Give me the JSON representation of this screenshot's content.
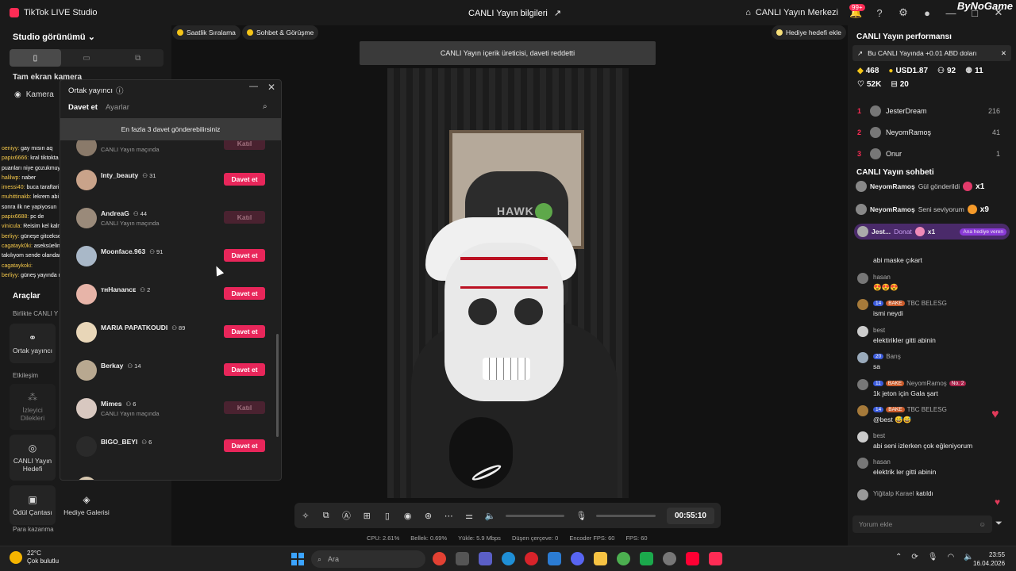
{
  "titlebar": {
    "app_name": "TikTok LIVE Studio",
    "live_info": "CANLI Yayın bilgileri",
    "live_center": "CANLI Yayın Merkezi",
    "notif_badge": "99+",
    "brand": "ByNoGame"
  },
  "left": {
    "studio_view": "Studio görünümü",
    "fullscreen_camera": "Tam ekran kamera",
    "camera": "Kamera",
    "tools_title": "Araçlar",
    "together_label": "Birlikte CANLI Y",
    "cohost": "Ortak yayıncı",
    "interaction_label": "Etkileşim",
    "viewer_requests": "İzleyici Dilekleri",
    "live_goal": "CANLI Yayın Hedefi",
    "reward_bag": "Ödül Çantası",
    "gift_gallery": "Hediye Galerisi",
    "earn_label": "Para kazanma",
    "overlay_chat": [
      {
        "user": "oeniyy:",
        "text": "gay mısın aq"
      },
      {
        "user": "papix6666:",
        "text": "kral tiktokta savas puanları niye gozukmuyor"
      },
      {
        "user": "halilwp:",
        "text": "naber"
      },
      {
        "user": "imessi40:",
        "text": "buca taraftari"
      },
      {
        "user": "muhittinakb:",
        "text": "lekrem abi uyandıktan sonra ilk ne yapiyosun"
      },
      {
        "user": "papix6688:",
        "text": "pc de"
      },
      {
        "user": "vinicula:",
        "text": "Reisim kel kalmışsın"
      },
      {
        "user": "berliyy:",
        "text": "güneşe gitcekse durcan"
      },
      {
        "user": "cagatayk0ki:",
        "text": "aseksüelim dalgasına takılıyom sende olandan"
      },
      {
        "user": "cagataykoki:",
        "text": ""
      },
      {
        "user": "berliyy:",
        "text": "güneş yayında mı"
      }
    ]
  },
  "top_pills": {
    "ranking": "Saatlik Sıralama",
    "chat_meet": "Sohbet & Görüşme",
    "gift_goal": "Hediye hedefi ekle"
  },
  "notification": "CANLI Yayın içerik üreticisi, daveti reddetti",
  "video": {
    "chair_text": "HAWK"
  },
  "dialog": {
    "title": "Ortak yayıncı",
    "tab_invite": "Davet et",
    "tab_settings": "Ayarlar",
    "limit_notice": "En fazla 3 davet gönderebilirsiniz",
    "items": [
      {
        "name": "Inty_beauty",
        "followers": "31",
        "sub": "",
        "action": "Davet et"
      },
      {
        "name": "AndreaG",
        "followers": "44",
        "sub": "CANLI Yayın maçında",
        "action": "Katıl"
      },
      {
        "name": "Moonface.963",
        "followers": "91",
        "sub": "",
        "action": "Davet et"
      },
      {
        "name": "тнHananᴄᴇ",
        "followers": "2",
        "sub": "",
        "action": "Davet et"
      },
      {
        "name": "MARIA PAPATKOUDI",
        "followers": "89",
        "sub": "",
        "action": "Davet et"
      },
      {
        "name": "Berkay",
        "followers": "14",
        "sub": "",
        "action": "Davet et"
      },
      {
        "name": "Mimes",
        "followers": "6",
        "sub": "CANLI Yayın maçında",
        "action": "Katıl"
      },
      {
        "name": "BIGO_BEYI",
        "followers": "6",
        "sub": "",
        "action": "Davet et"
      }
    ],
    "partial_top_sub": "CANLI Yayın maçında",
    "partial_top_action": "Katıl"
  },
  "toolbar": {
    "timer": "00:55:10"
  },
  "stats": {
    "cpu": "CPU: 2.61%",
    "memory": "Bellek: 0.69%",
    "upload": "Yükle: 5.9 Mbps",
    "dropped": "Düşen çerçeve: 0",
    "encoder_fps": "Encoder FPS: 60",
    "fps": "FPS: 60"
  },
  "right": {
    "perf_title": "CANLI Yayın performansı",
    "earn_notice": "Bu CANLI Yayında +0.01 ABD doları",
    "diamonds": "468",
    "usd": "USD1.87",
    "viewers": "92",
    "new_followers": "11",
    "likes": "52K",
    "gifters": "20",
    "ranking": [
      {
        "rank": "1",
        "name": "JesterDream",
        "score": "216"
      },
      {
        "rank": "2",
        "name": "NeyomRamoş",
        "score": "41"
      },
      {
        "rank": "3",
        "name": "Onur",
        "score": "1"
      }
    ],
    "chat_title": "CANLI Yayın sohbeti",
    "gifts": [
      {
        "user": "NeyomRamoş",
        "text": "Gül gönderildi",
        "count": "x1"
      },
      {
        "user": "NeyomRamoş",
        "text": "Seni seviyorum",
        "count": "x9"
      }
    ],
    "special_gift": {
      "user": "Jest...",
      "text": "Donat",
      "count": "x1",
      "tag": "Ana hediye veren"
    },
    "messages": [
      {
        "name": "",
        "level": "",
        "fan": "",
        "extra": "",
        "text": "abi maske çıkart"
      },
      {
        "name": "hasan",
        "level": "",
        "fan": "",
        "extra": "",
        "text": "😍😍😍"
      },
      {
        "name": "TBC BELESG",
        "level": "14",
        "fan": "BAKE",
        "extra": "",
        "text": "ismi neydi"
      },
      {
        "name": "best",
        "level": "",
        "fan": "",
        "extra": "",
        "text": "elektirikler gitti abinin"
      },
      {
        "name": "Barış",
        "level": "20",
        "fan": "",
        "extra": "",
        "text": "sa"
      },
      {
        "name": "NeyomRamoş",
        "level": "11",
        "fan": "BAKE",
        "extra": "No. 2",
        "text": "1k jeton için Gala şart"
      },
      {
        "name": "TBC BELESG",
        "level": "14",
        "fan": "BAKE",
        "extra": "",
        "text": "@best 😅😅"
      },
      {
        "name": "best",
        "level": "",
        "fan": "",
        "extra": "",
        "text": "abi seni izlerken çok eğleniyorum"
      },
      {
        "name": "hasan",
        "level": "",
        "fan": "",
        "extra": "",
        "text": "elektrik ler gitti abinin"
      },
      {
        "name": "Yiğitalp Karael",
        "level": "",
        "fan": "",
        "extra": "",
        "text": "katıldı"
      }
    ],
    "comment_placeholder": "Yorum ekle"
  },
  "taskbar": {
    "temp": "22°C",
    "weather": "Çok bulutlu",
    "search": "Ara",
    "time": "23:55",
    "date": "16.04.2026"
  },
  "colors": {
    "accent": "#fe2c55",
    "invite": "#e8265a",
    "bg": "#121212"
  }
}
